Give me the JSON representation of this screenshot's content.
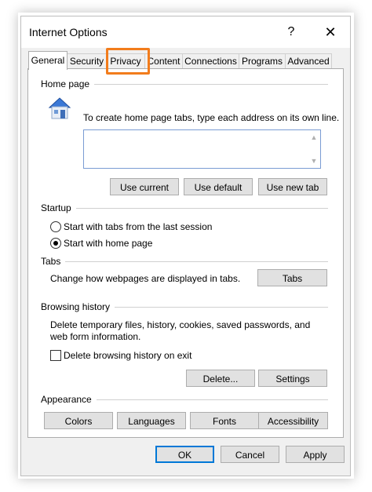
{
  "window": {
    "title": "Internet Options",
    "help_glyph": "?",
    "close_glyph": "✕"
  },
  "tabs": [
    {
      "label": "General",
      "active": true
    },
    {
      "label": "Security"
    },
    {
      "label": "Privacy",
      "highlighted": true
    },
    {
      "label": "Content"
    },
    {
      "label": "Connections"
    },
    {
      "label": "Programs"
    },
    {
      "label": "Advanced"
    }
  ],
  "homepage": {
    "group_label": "Home page",
    "instruction": "To create home page tabs, type each address on its own line.",
    "value": "",
    "use_current": "Use current",
    "use_default": "Use default",
    "use_new_tab": "Use new tab"
  },
  "startup": {
    "group_label": "Startup",
    "option_last_session": "Start with tabs from the last session",
    "option_home_page": "Start with home page",
    "selected": "home_page"
  },
  "tabs_group": {
    "group_label": "Tabs",
    "description": "Change how webpages are displayed in tabs.",
    "button": "Tabs"
  },
  "history": {
    "group_label": "Browsing history",
    "description_line1": "Delete temporary files, history, cookies, saved passwords, and",
    "description_line2": "web form information.",
    "delete_on_exit": "Delete browsing history on exit",
    "delete_on_exit_checked": false,
    "delete_button": "Delete...",
    "settings_button": "Settings"
  },
  "appearance": {
    "group_label": "Appearance",
    "colors": "Colors",
    "languages": "Languages",
    "fonts": "Fonts",
    "accessibility": "Accessibility"
  },
  "footer": {
    "ok": "OK",
    "cancel": "Cancel",
    "apply": "Apply"
  },
  "colors": {
    "highlight": "#f27c1c",
    "default_button_border": "#0078d7"
  }
}
